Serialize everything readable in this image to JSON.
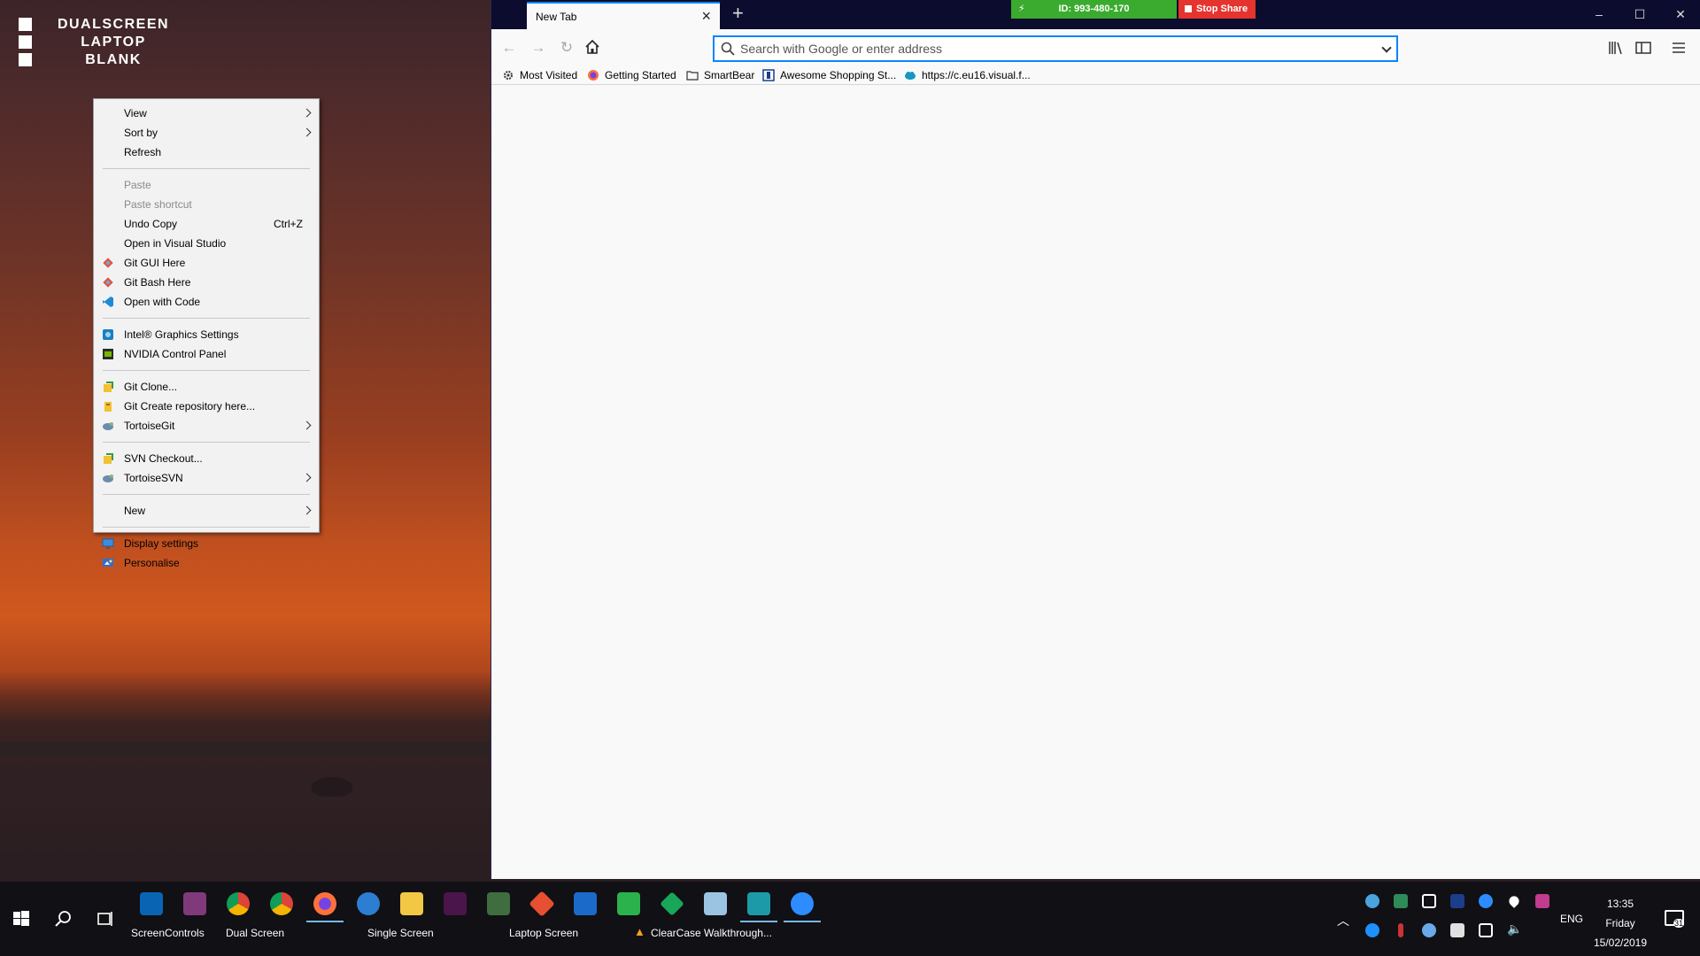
{
  "desktop": {
    "logo_lines": [
      "DUALSCREEN",
      "LAPTOP",
      "BLANK"
    ]
  },
  "context_menu": {
    "items": [
      {
        "label": "View",
        "submenu": true
      },
      {
        "label": "Sort by",
        "submenu": true
      },
      {
        "label": "Refresh"
      },
      {
        "label": "Paste",
        "disabled": true
      },
      {
        "label": "Paste shortcut",
        "disabled": true
      },
      {
        "label": "Undo Copy",
        "shortcut": "Ctrl+Z"
      },
      {
        "label": "Open in Visual Studio"
      },
      {
        "label": "Git GUI Here",
        "icon": "git-icon"
      },
      {
        "label": "Git Bash Here",
        "icon": "git-icon"
      },
      {
        "label": "Open with Code",
        "icon": "vscode-icon"
      },
      {
        "label": "Intel® Graphics Settings",
        "icon": "intel-graphics-icon"
      },
      {
        "label": "NVIDIA Control Panel",
        "icon": "nvidia-icon"
      },
      {
        "label": "Git Clone...",
        "icon": "git-clone-icon"
      },
      {
        "label": "Git Create repository here...",
        "icon": "git-create-icon"
      },
      {
        "label": "TortoiseGit",
        "icon": "tortoisegit-icon",
        "submenu": true
      },
      {
        "label": "SVN Checkout...",
        "icon": "svn-checkout-icon"
      },
      {
        "label": "TortoiseSVN",
        "icon": "tortoisesvn-icon",
        "submenu": true
      },
      {
        "label": "New",
        "submenu": true
      },
      {
        "label": "Display settings",
        "icon": "display-settings-icon"
      },
      {
        "label": "Personalise",
        "icon": "personalise-icon"
      }
    ]
  },
  "browser": {
    "tab_title": "New Tab",
    "urlbar_placeholder": "Search with Google or enter address",
    "zoom": {
      "meeting_id": "ID: 993-480-170",
      "stop_share": "Stop Share"
    },
    "bookmarks": [
      {
        "label": "Most Visited",
        "icon": "gear-icon"
      },
      {
        "label": "Getting Started",
        "icon": "firefox-icon"
      },
      {
        "label": "SmartBear",
        "icon": "folder-icon"
      },
      {
        "label": "Awesome Shopping St...",
        "icon": "shopping-icon"
      },
      {
        "label": "https://c.eu16.visual.f...",
        "icon": "salesforce-cloud-icon"
      }
    ]
  },
  "taskbar": {
    "labels": {
      "screencontrols": "ScreenControls",
      "dual": "Dual Screen",
      "single": "Single Screen",
      "laptop": "Laptop Screen",
      "clearcase": "ClearCase Walkthrough..."
    },
    "language": "ENG",
    "time": "13:35",
    "day": "Friday",
    "date": "15/02/2019",
    "notification_count": "31"
  },
  "colors": {
    "firefox_titlebar": "#0c0c2e",
    "focus_blue": "#0a84ff",
    "zoom_green": "#3aab2e",
    "stop_red": "#e5332e",
    "taskbar": "#101015"
  }
}
